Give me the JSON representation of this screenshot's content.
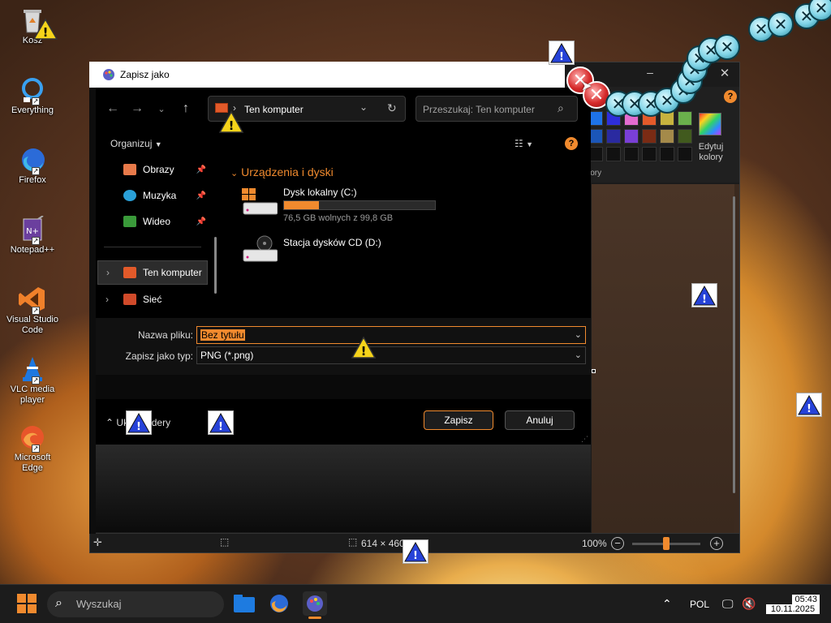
{
  "desktop": {
    "icons": [
      {
        "label": "Kosz"
      },
      {
        "label": "Everything"
      },
      {
        "label": "Firefox"
      },
      {
        "label": "Notepad++"
      },
      {
        "label": "Visual Studio Code"
      },
      {
        "label": "VLC media player"
      },
      {
        "label": "Microsoft Edge"
      }
    ]
  },
  "paint": {
    "edit_colors_label": "Edytuj kolory",
    "colors_label": "lory",
    "status": {
      "dims": "614 × 460",
      "zoom": "100%"
    },
    "palette": [
      "#1e73e8",
      "#2e2edb",
      "#e36bd0",
      "#e35a2a",
      "#c7b33e",
      "#6ab04c",
      "#1b56b8",
      "#2a2aa0",
      "#7a3fd6",
      "#7a2b14",
      "#a48a4a",
      "#415a1e",
      "#111111",
      "#111111",
      "#111111",
      "#111111",
      "#111111",
      "#111111"
    ],
    "accent": "#f08a2e"
  },
  "dialog": {
    "title": "Zapisz jako",
    "address": "Ten komputer",
    "search_placeholder": "Przeszukaj: Ten komputer",
    "organize": "Organizuj",
    "help": "?",
    "sidebar": [
      {
        "label": "Obrazy",
        "pinned": true
      },
      {
        "label": "Muzyka",
        "pinned": true
      },
      {
        "label": "Wideo",
        "pinned": true
      },
      {
        "label": "Ten komputer",
        "selected": true
      },
      {
        "label": "Sieć"
      }
    ],
    "group_header": "Urządzenia i dyski",
    "drives": [
      {
        "name": "Dysk lokalny (C:)",
        "free": "76,5 GB wolnych z 99,8 GB",
        "used_fraction": 0.23
      },
      {
        "name": "Stacja dysków CD (D:)"
      }
    ],
    "filename_label": "Nazwa pliku:",
    "filename_value": "Bez tytułu",
    "filetype_label": "Zapisz jako typ:",
    "filetype_value": "PNG (*.png)",
    "hide_folders": "Ukryj foldery",
    "save": "Zapisz",
    "cancel": "Anuluj"
  },
  "taskbar": {
    "search_placeholder": "Wyszukaj",
    "language": "POL",
    "time": "05:43",
    "date": "10.11.2025"
  }
}
